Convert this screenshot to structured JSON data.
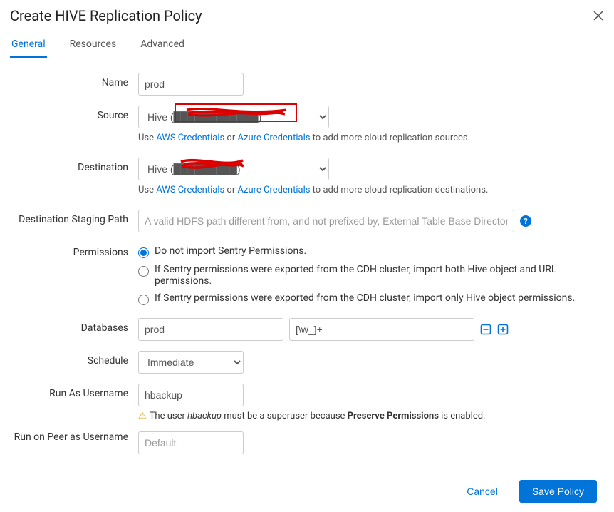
{
  "dialog": {
    "title": "Create HIVE Replication Policy"
  },
  "tabs": [
    {
      "label": "General",
      "active": true
    },
    {
      "label": "Resources",
      "active": false
    },
    {
      "label": "Advanced",
      "active": false
    }
  ],
  "fields": {
    "name": {
      "label": "Name",
      "value": "prod"
    },
    "source": {
      "label": "Source",
      "selected": "Hive (████████████)",
      "hint_prefix": "Use ",
      "hint_link1": "AWS Credentials",
      "hint_mid": " or ",
      "hint_link2": "Azure Credentials",
      "hint_suffix": " to add more cloud replication sources."
    },
    "destination": {
      "label": "Destination",
      "selected": "Hive (█████████)",
      "hint_prefix": "Use ",
      "hint_link1": "AWS Credentials",
      "hint_mid": " or ",
      "hint_link2": "Azure Credentials",
      "hint_suffix": " to add more cloud replication destinations."
    },
    "staging_path": {
      "label": "Destination Staging Path",
      "placeholder": "A valid HDFS path different from, and not prefixed by, External Table Base Directory"
    },
    "permissions": {
      "label": "Permissions",
      "options": [
        {
          "label": "Do not import Sentry Permissions.",
          "checked": true
        },
        {
          "label": "If Sentry permissions were exported from the CDH cluster, import both Hive object and URL permissions.",
          "checked": false
        },
        {
          "label": "If Sentry permissions were exported from the CDH cluster, import only Hive object permissions.",
          "checked": false
        }
      ]
    },
    "databases": {
      "label": "Databases",
      "db_value": "prod",
      "pattern_value": "[\\w_]+"
    },
    "schedule": {
      "label": "Schedule",
      "selected": "Immediate"
    },
    "run_as": {
      "label": "Run As Username",
      "value": "hbackup",
      "warning_pre": "The user ",
      "warning_user": "hbackup",
      "warning_mid": " must be a superuser because ",
      "warning_bold": "Preserve Permissions",
      "warning_post": " is enabled."
    },
    "run_on_peer": {
      "label": "Run on Peer as Username",
      "placeholder": "Default"
    }
  },
  "footer": {
    "cancel": "Cancel",
    "save": "Save Policy"
  }
}
